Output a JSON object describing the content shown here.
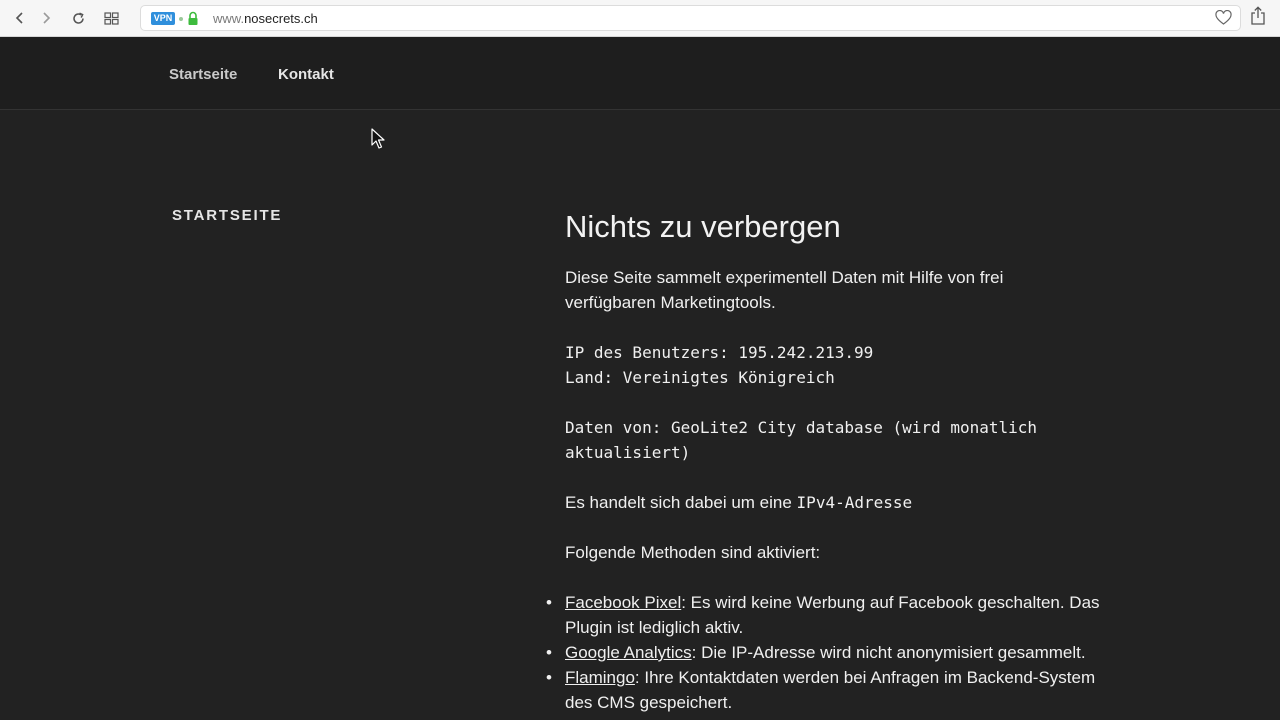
{
  "browser": {
    "vpn_label": "VPN",
    "url_prefix": "www.",
    "url_domain": "nosecrets.ch",
    "icons": [
      "back-icon",
      "forward-icon",
      "reload-icon",
      "tabs-grid-icon",
      "lock-icon",
      "heart-icon",
      "share-icon"
    ],
    "colors": {
      "vpn": "#2f8fdc",
      "lock": "#3dbb3d"
    }
  },
  "nav": {
    "home": "Startseite",
    "contact": "Kontakt"
  },
  "sidebar": {
    "title": "STARTSEITE"
  },
  "main": {
    "heading": "Nichts zu verbergen",
    "intro_line1": "Diese Seite sammelt experimentell Daten mit Hilfe von frei",
    "intro_line2": "verfügbaren Marketingtools.",
    "ip_line": "IP des Benutzers: 195.242.213.99",
    "country_line": "Land: Vereinigtes Königreich",
    "source_line1": "Daten von: GeoLite2 City database (wird monatlich",
    "source_line2": "aktualisiert)",
    "ipv_text": "Es handelt sich dabei um eine",
    "ipv_mono": "IPv4-Adresse",
    "methods_title": "Folgende Methoden sind aktiviert:",
    "methods": [
      {
        "link": "Facebook Pixel",
        "line1": ": Es wird keine Werbung auf Facebook geschalten. Das",
        "line2": "Plugin ist lediglich aktiv."
      },
      {
        "link": "Google Analytics",
        "line1": ": Die IP-Adresse wird nicht anonymisiert gesammelt.",
        "line2": ""
      },
      {
        "link": "Flamingo",
        "line1": ": Ihre Kontaktdaten werden bei Anfragen im Backend-System",
        "line2": "des CMS gespeichert."
      }
    ]
  }
}
